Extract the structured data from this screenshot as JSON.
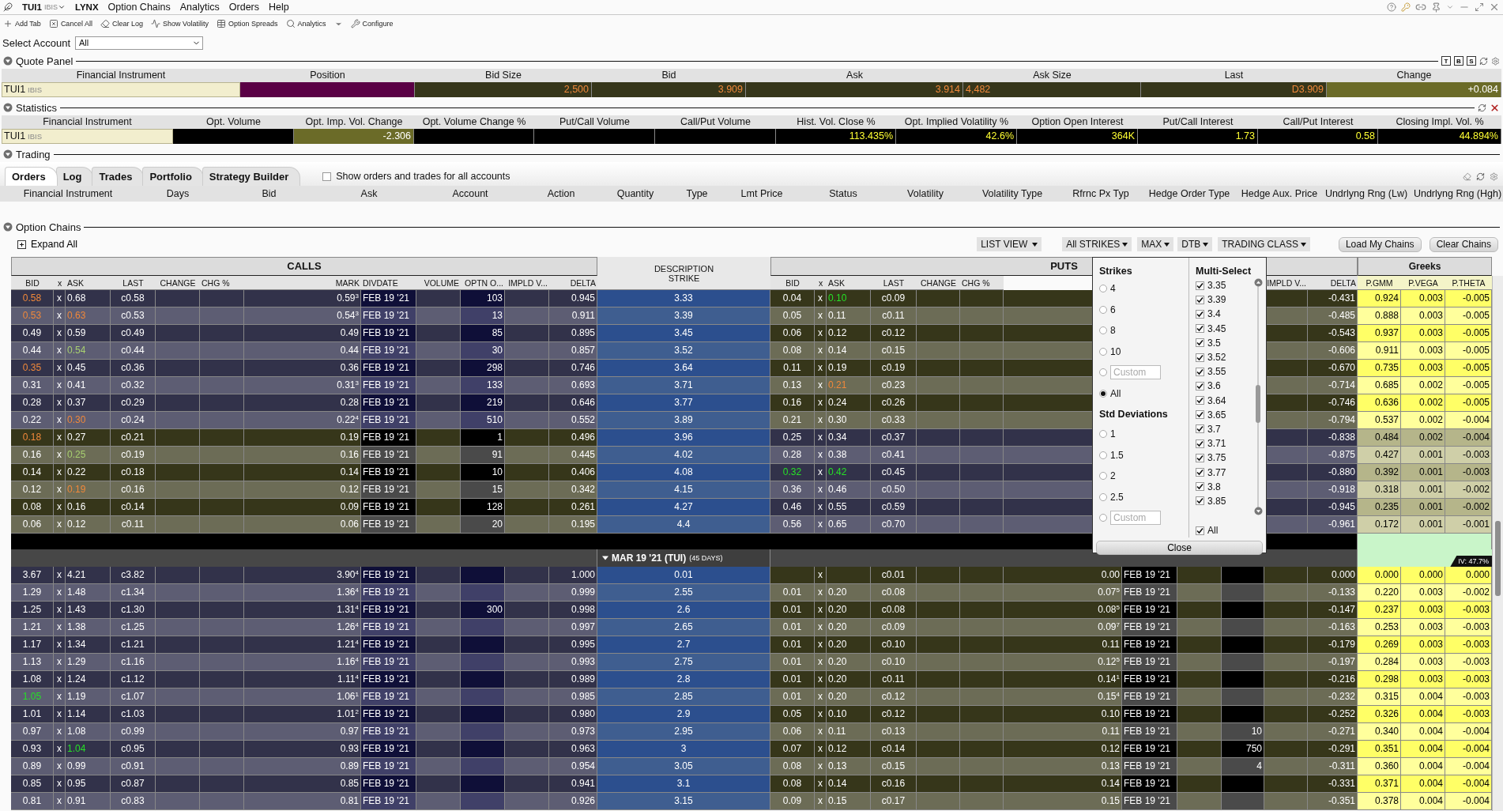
{
  "menu_bar": {
    "symbol": "TUI1",
    "exchange": "IBIS",
    "brand": "LYNX",
    "menus": [
      "Option Chains",
      "Analytics",
      "Orders",
      "Help"
    ]
  },
  "toolbar": [
    {
      "kind": "add",
      "label": "Add Tab"
    },
    {
      "kind": "cancel",
      "label": "Cancel All"
    },
    {
      "kind": "clear",
      "label": "Clear Log"
    },
    {
      "kind": "volatility",
      "label": "Show Volatility"
    },
    {
      "kind": "spreads",
      "label": "Option Spreads"
    },
    {
      "kind": "analytics",
      "label": "Analytics"
    },
    {
      "kind": "dropdown"
    },
    {
      "kind": "configure",
      "label": "Configure"
    }
  ],
  "account": {
    "label": "Select Account",
    "value": "All"
  },
  "quote_panel": {
    "title": "Quote Panel",
    "expanded": true,
    "tools": [
      "T",
      "B",
      "S"
    ],
    "columns": [
      "Financial Instrument",
      "Position",
      "Bid Size",
      "Bid",
      "Ask",
      "Ask Size",
      "Last",
      "Change"
    ],
    "row": {
      "instrument": "TUI1",
      "exchange": "IBIS",
      "bid_size": "2,500",
      "bid": "3.909",
      "ask": "3.914",
      "ask_size": "4,482",
      "last": "D3.909",
      "change": "+0.084"
    }
  },
  "statistics": {
    "title": "Statistics",
    "expanded": true,
    "columns": [
      "Financial Instrument",
      "Opt. Volume",
      "Opt. Imp. Vol. Change",
      "Opt. Volume Change %",
      "Put/Call Volume",
      "Call/Put Volume",
      "Hist. Vol. Close %",
      "Opt. Implied Volatility %",
      "Option Open Interest",
      "Put/Call Interest",
      "Call/Put Interest",
      "Closing Impl. Vol. %"
    ],
    "row": {
      "instrument": "TUI1",
      "exchange": "IBIS",
      "imp_vol_change": "-2.306",
      "hist_vol_close": "113.435%",
      "implied_vol": "42.6%",
      "open_interest": "364K",
      "put_call_interest": "1.73",
      "call_put_interest": "0.58",
      "closing_impl_vol": "44.894%"
    }
  },
  "trading": {
    "title": "Trading",
    "expanded": true,
    "tabs": [
      {
        "label": "Orders",
        "selected": true
      },
      {
        "label": "Log",
        "selected": false
      },
      {
        "label": "Trades",
        "selected": false
      },
      {
        "label": "Portfolio",
        "selected": false
      },
      {
        "label": "Strategy Builder",
        "selected": false
      }
    ],
    "all_accounts": {
      "label": "Show orders and trades for all accounts",
      "checked": false
    },
    "columns": [
      "Financial Instrument",
      "Days",
      "Bid",
      "Ask",
      "Account",
      "Action",
      "Quantity",
      "Type",
      "Lmt Price",
      "Status",
      "Volatility",
      "Volatility Type",
      "Rfrnc Px Typ",
      "Hedge Order Type",
      "Hedge Aux. Price",
      "Undrlyng Rng (Lw)",
      "Undrlyng Rng (Hgh)"
    ]
  },
  "option_chains": {
    "title": "Option Chains",
    "expanded": true,
    "expand_all": "Expand All",
    "controls": [
      {
        "label": "LIST VIEW",
        "kind": "dropdown"
      },
      {
        "label": "All STRIKES",
        "kind": "dropdown"
      },
      {
        "label": "MAX",
        "kind": "dropdown"
      },
      {
        "label": "DTB",
        "kind": "dropdown"
      },
      {
        "label": "TRADING CLASS",
        "kind": "dropdown"
      },
      {
        "label": "Load My Chains",
        "kind": "button"
      },
      {
        "label": "Clear Chains",
        "kind": "button"
      }
    ],
    "strike_popup": {
      "strikes_title": "Strikes",
      "strikes": [
        {
          "label": "4",
          "selected": false
        },
        {
          "label": "6",
          "selected": false
        },
        {
          "label": "8",
          "selected": false
        },
        {
          "label": "10",
          "selected": false
        },
        {
          "placeholder": "Custom",
          "selected": false
        },
        {
          "label": "All",
          "selected": true
        }
      ],
      "std_title": "Std Deviations",
      "std_devs": [
        {
          "label": "1",
          "selected": false
        },
        {
          "label": "1.5",
          "selected": false
        },
        {
          "label": "2",
          "selected": false
        },
        {
          "label": "2.5",
          "selected": false
        },
        {
          "placeholder": "Custom",
          "selected": false
        }
      ],
      "multi_title": "Multi-Select",
      "multi": [
        {
          "label": "3.35",
          "checked": true
        },
        {
          "label": "3.39",
          "checked": true
        },
        {
          "label": "3.4",
          "checked": true
        },
        {
          "label": "3.45",
          "checked": true
        },
        {
          "label": "3.5",
          "checked": true
        },
        {
          "label": "3.52",
          "checked": true
        },
        {
          "label": "3.55",
          "checked": true
        },
        {
          "label": "3.6",
          "checked": true
        },
        {
          "label": "3.64",
          "checked": true
        },
        {
          "label": "3.65",
          "checked": true
        },
        {
          "label": "3.7",
          "checked": true
        },
        {
          "label": "3.71",
          "checked": true
        },
        {
          "label": "3.75",
          "checked": true
        },
        {
          "label": "3.77",
          "checked": true
        },
        {
          "label": "3.8",
          "checked": true
        },
        {
          "label": "3.85",
          "checked": true
        }
      ],
      "multi_all": {
        "label": "All",
        "checked": true
      },
      "close": "Close"
    },
    "chain": {
      "calls_title": "CALLS",
      "puts_title": "PUTS",
      "greeks_title": "Greeks",
      "strike_header": [
        "DESCRIPTION",
        "STRIKE"
      ],
      "call_columns": [
        "BID",
        "x",
        "ASK",
        "LAST",
        "CHANGE",
        "CHG %",
        "MARK",
        "DIVDATE",
        "VOLUME",
        "OPTN O...",
        "IMPLD V...",
        "DELTA"
      ],
      "put_columns_left": [
        "BID",
        "x",
        "ASK",
        "LAST",
        "CHANGE",
        "CHG %"
      ],
      "put_columns_right": [
        "IMPLD V...",
        "DELTA"
      ],
      "greek_columns": [
        "P.GMM",
        "P.VEGA",
        "P.THETA"
      ],
      "groups": [
        {
          "rows": [
            {
              "strike": "3.33",
              "itm": true,
              "call": {
                "bid": {
                  "text": "0.58",
                  "color": "#f0883a"
                },
                "x": "x",
                "ask": "0.68",
                "last": "c0.58",
                "mark": "0.59$^{3}$",
                "divdate": "FEB 19 '21",
                "open_int": "103",
                "delta": "0.945"
              },
              "put": {
                "bid": "0.04",
                "x": "x",
                "ask": {
                  "text": "0.10",
                  "color": "#26e026"
                },
                "last": "c0.09",
                "delta": "-0.431"
              },
              "greeks": [
                "0.924",
                "0.003",
                "-0.005"
              ]
            },
            {
              "strike": "3.39",
              "itm": true,
              "call": {
                "bid": {
                  "text": "0.53",
                  "color": "#f0883a"
                },
                "x": "x",
                "ask": {
                  "text": "0.63",
                  "color": "#f0883a"
                },
                "last": "c0.53",
                "mark": "0.54$^{3}$",
                "divdate": "FEB 19 '21",
                "open_int": "13",
                "delta": "0.911"
              },
              "put": {
                "bid": "0.05",
                "x": "x",
                "ask": "0.11",
                "last": "c0.11",
                "delta": "-0.485"
              },
              "greeks": [
                "0.888",
                "0.003",
                "-0.005"
              ]
            },
            {
              "strike": "3.45",
              "itm": true,
              "call": {
                "bid": "0.49",
                "x": "x",
                "ask": "0.59",
                "last": "c0.49",
                "mark": "0.49",
                "divdate": "FEB 19 '21",
                "open_int": "85",
                "delta": "0.895"
              },
              "put": {
                "bid": "0.06",
                "x": "x",
                "ask": "0.12",
                "last": "c0.12",
                "delta": "-0.543"
              },
              "greeks": [
                "0.937",
                "0.003",
                "-0.005"
              ]
            },
            {
              "strike": "3.52",
              "itm": true,
              "call": {
                "bid": "0.44",
                "x": "x",
                "ask": {
                  "text": "0.54",
                  "color": "#a8d070"
                },
                "last": "c0.44",
                "mark": "0.44",
                "divdate": "FEB 19 '21",
                "open_int": "30",
                "delta": "0.857"
              },
              "put": {
                "bid": "0.08",
                "x": "x",
                "ask": "0.14",
                "last": "c0.15",
                "delta": "-0.606"
              },
              "greeks": [
                "0.911",
                "0.003",
                "-0.005"
              ]
            },
            {
              "strike": "3.64",
              "itm": true,
              "call": {
                "bid": {
                  "text": "0.35",
                  "color": "#f0883a"
                },
                "x": "x",
                "ask": "0.45",
                "last": "c0.36",
                "mark": "0.36",
                "divdate": "FEB 19 '21",
                "open_int": "298",
                "delta": "0.746"
              },
              "put": {
                "bid": "0.11",
                "x": "x",
                "ask": "0.19",
                "last": "c0.19",
                "delta": "-0.670"
              },
              "greeks": [
                "0.735",
                "0.003",
                "-0.005"
              ]
            },
            {
              "strike": "3.71",
              "itm": true,
              "call": {
                "bid": "0.31",
                "x": "x",
                "ask": "0.41",
                "last": "c0.32",
                "mark": "0.31$^{3}$",
                "divdate": "FEB 19 '21",
                "open_int": "133",
                "delta": "0.693"
              },
              "put": {
                "bid": "0.13",
                "x": "x",
                "ask": {
                  "text": "0.21",
                  "color": "#f0883a"
                },
                "last": "c0.23",
                "delta": "-0.714"
              },
              "greeks": [
                "0.685",
                "0.002",
                "-0.005"
              ]
            },
            {
              "strike": "3.77",
              "itm": true,
              "call": {
                "bid": "0.28",
                "x": "x",
                "ask": "0.37",
                "last": "c0.29",
                "mark": "0.28",
                "divdate": "FEB 19 '21",
                "open_int": "219",
                "delta": "0.646"
              },
              "put": {
                "bid": "0.16",
                "x": "x",
                "ask": "0.24",
                "last": "c0.26",
                "delta": "-0.746"
              },
              "greeks": [
                "0.636",
                "0.002",
                "-0.005"
              ]
            },
            {
              "strike": "3.89",
              "itm": true,
              "call": {
                "bid": "0.22",
                "x": "x",
                "ask": {
                  "text": "0.30",
                  "color": "#f0883a"
                },
                "last": "c0.24",
                "mark": "0.22$^{4}$",
                "divdate": "FEB 19 '21",
                "open_int": "510",
                "delta": "0.552"
              },
              "put": {
                "bid": "0.21",
                "x": "x",
                "ask": "0.30",
                "last": "c0.33",
                "delta": "-0.794"
              },
              "greeks": [
                "0.537",
                "0.002",
                "-0.004"
              ]
            },
            {
              "strike": "3.96",
              "itm": false,
              "call": {
                "bid": {
                  "text": "0.18",
                  "color": "#f0883a"
                },
                "x": "x",
                "ask": "0.27",
                "last": "c0.21",
                "mark": "0.19",
                "divdate": "FEB 19 '21",
                "open_int": "1",
                "delta": "0.496"
              },
              "put": {
                "bid": "0.25",
                "x": "x",
                "ask": "0.34",
                "last": "c0.37",
                "delta": "-0.838"
              },
              "greeks": [
                "0.484",
                "0.002",
                "-0.004"
              ]
            },
            {
              "strike": "4.02",
              "itm": false,
              "call": {
                "bid": "0.16",
                "x": "x",
                "ask": {
                  "text": "0.25",
                  "color": "#a8d070"
                },
                "last": "c0.19",
                "mark": "0.16",
                "divdate": "FEB 19 '21",
                "open_int": "91",
                "delta": "0.445"
              },
              "put": {
                "bid": "0.28",
                "x": "x",
                "ask": "0.38",
                "last": "c0.41",
                "delta": "-0.875"
              },
              "greeks": [
                "0.427",
                "0.001",
                "-0.003"
              ]
            },
            {
              "strike": "4.08",
              "itm": false,
              "call": {
                "bid": "0.14",
                "x": "x",
                "ask": "0.22",
                "last": "c0.18",
                "mark": "0.14",
                "divdate": "FEB 19 '21",
                "open_int": "10",
                "delta": "0.406"
              },
              "put": {
                "bid": {
                  "text": "0.32",
                  "color": "#26e026"
                },
                "x": "x",
                "ask": {
                  "text": "0.42",
                  "color": "#26e026"
                },
                "last": "c0.45",
                "delta": "-0.880"
              },
              "greeks": [
                "0.392",
                "0.001",
                "-0.003"
              ]
            },
            {
              "strike": "4.15",
              "itm": false,
              "call": {
                "bid": "0.12",
                "x": "x",
                "ask": {
                  "text": "0.19",
                  "color": "#f0883a"
                },
                "last": "c0.16",
                "mark": "0.12",
                "divdate": "FEB 19 '21",
                "open_int": "15",
                "delta": "0.342"
              },
              "put": {
                "bid": "0.36",
                "x": "x",
                "ask": "0.46",
                "last": "c0.50",
                "delta": "-0.918"
              },
              "greeks": [
                "0.318",
                "0.001",
                "-0.002"
              ]
            },
            {
              "strike": "4.27",
              "itm": false,
              "call": {
                "bid": "0.08",
                "x": "x",
                "ask": "0.16",
                "last": "c0.14",
                "mark": "0.09",
                "divdate": "FEB 19 '21",
                "open_int": "128",
                "delta": "0.261"
              },
              "put": {
                "bid": "0.46",
                "x": "x",
                "ask": "0.55",
                "last": "c0.59",
                "delta": "-0.945"
              },
              "greeks": [
                "0.235",
                "0.001",
                "-0.002"
              ]
            },
            {
              "strike": "4.4",
              "itm": false,
              "call": {
                "bid": "0.06",
                "x": "x",
                "ask": "0.12",
                "last": "c0.11",
                "mark": "0.06",
                "divdate": "FEB 19 '21",
                "open_int": "20",
                "delta": "0.195"
              },
              "put": {
                "bid": "0.56",
                "x": "x",
                "ask": "0.65",
                "last": "c0.70",
                "delta": "-0.961"
              },
              "greeks": [
                "0.172",
                "0.001",
                "-0.001"
              ]
            }
          ]
        },
        {
          "expiry": {
            "label": "MAR 19 '21 (TUI)",
            "days": "(45 DAYS)",
            "expanded": true,
            "iv": "IV: 47.7%"
          },
          "rows": [
            {
              "strike": "0.01",
              "itm": true,
              "call": {
                "bid": "3.67",
                "x": "x",
                "ask": "4.21",
                "last": "c3.82",
                "mark": "3.90$^{4}$",
                "divdate": "FEB 19 '21",
                "delta": "1.000"
              },
              "put": {
                "x": "x",
                "last": "c0.01",
                "mark": "0.00",
                "divdate": "FEB 19 '21",
                "delta": "0.000"
              },
              "greeks": [
                "0.000",
                "0.000",
                "0.000"
              ]
            },
            {
              "strike": "2.55",
              "itm": true,
              "call": {
                "bid": "1.29",
                "x": "x",
                "ask": "1.48",
                "last": "c1.34",
                "mark": "1.36$^{4}$",
                "divdate": "FEB 19 '21",
                "delta": "0.999"
              },
              "put": {
                "bid": "0.01",
                "x": "x",
                "ask": "0.20",
                "last": "c0.08",
                "mark": "0.07$^{5}$",
                "divdate": "FEB 19 '21",
                "delta": "-0.133"
              },
              "greeks": [
                "0.220",
                "0.003",
                "-0.002"
              ]
            },
            {
              "strike": "2.6",
              "itm": true,
              "call": {
                "bid": "1.25",
                "x": "x",
                "ask": "1.43",
                "last": "c1.30",
                "mark": "1.31$^{4}$",
                "divdate": "FEB 19 '21",
                "open_int": "300",
                "delta": "0.998"
              },
              "put": {
                "bid": "0.01",
                "x": "x",
                "ask": "0.20",
                "last": "c0.08",
                "mark": "0.08$^{5}$",
                "divdate": "FEB 19 '21",
                "delta": "-0.147"
              },
              "greeks": [
                "0.237",
                "0.003",
                "-0.003"
              ]
            },
            {
              "strike": "2.65",
              "itm": true,
              "call": {
                "bid": "1.21",
                "x": "x",
                "ask": "1.38",
                "last": "c1.25",
                "mark": "1.26$^{4}$",
                "divdate": "FEB 19 '21",
                "delta": "0.997"
              },
              "put": {
                "bid": "0.01",
                "x": "x",
                "ask": "0.20",
                "last": "c0.09",
                "mark": "0.09$^{7}$",
                "divdate": "FEB 19 '21",
                "delta": "-0.163"
              },
              "greeks": [
                "0.253",
                "0.003",
                "-0.003"
              ]
            },
            {
              "strike": "2.7",
              "itm": true,
              "call": {
                "bid": "1.17",
                "x": "x",
                "ask": "1.34",
                "last": "c1.21",
                "mark": "1.21$^{4}$",
                "divdate": "FEB 19 '21",
                "delta": "0.995"
              },
              "put": {
                "bid": "0.01",
                "x": "x",
                "ask": "0.20",
                "last": "c0.10",
                "mark": "0.11",
                "divdate": "FEB 19 '21",
                "delta": "-0.179"
              },
              "greeks": [
                "0.269",
                "0.003",
                "-0.003"
              ]
            },
            {
              "strike": "2.75",
              "itm": true,
              "call": {
                "bid": "1.13",
                "x": "x",
                "ask": "1.29",
                "last": "c1.16",
                "mark": "1.16$^{4}$",
                "divdate": "FEB 19 '21",
                "delta": "0.993"
              },
              "put": {
                "bid": "0.01",
                "x": "x",
                "ask": "0.20",
                "last": "c0.10",
                "mark": "0.12$^{5}$",
                "divdate": "FEB 19 '21",
                "delta": "-0.197"
              },
              "greeks": [
                "0.284",
                "0.003",
                "-0.003"
              ]
            },
            {
              "strike": "2.8",
              "itm": true,
              "call": {
                "bid": "1.08",
                "x": "x",
                "ask": "1.24",
                "last": "c1.12",
                "mark": "1.11$^{4}$",
                "divdate": "FEB 19 '21",
                "delta": "0.989"
              },
              "put": {
                "bid": "0.01",
                "x": "x",
                "ask": "0.20",
                "last": "c0.11",
                "mark": "0.14$^{1}$",
                "divdate": "FEB 19 '21",
                "delta": "-0.216"
              },
              "greeks": [
                "0.298",
                "0.003",
                "-0.003"
              ]
            },
            {
              "strike": "2.85",
              "itm": true,
              "call": {
                "bid": {
                  "text": "1.05",
                  "color": "#26e026"
                },
                "x": "x",
                "ask": "1.19",
                "last": "c1.07",
                "mark": "1.06$^{1}$",
                "divdate": "FEB 19 '21",
                "delta": "0.985"
              },
              "put": {
                "bid": "0.01",
                "x": "x",
                "ask": "0.20",
                "last": "c0.12",
                "mark": "0.15$^{4}$",
                "divdate": "FEB 19 '21",
                "delta": "-0.232"
              },
              "greeks": [
                "0.315",
                "0.004",
                "-0.003"
              ]
            },
            {
              "strike": "2.9",
              "itm": true,
              "call": {
                "bid": "1.01",
                "x": "x",
                "ask": "1.14",
                "last": "c1.03",
                "mark": "1.01$^{2}$",
                "divdate": "FEB 19 '21",
                "delta": "0.980"
              },
              "put": {
                "bid": "0.05",
                "x": "x",
                "ask": "0.10",
                "last": "c0.12",
                "mark": "0.10",
                "divdate": "FEB 19 '21",
                "delta": "-0.252"
              },
              "greeks": [
                "0.326",
                "0.004",
                "-0.003"
              ]
            },
            {
              "strike": "2.95",
              "itm": true,
              "call": {
                "bid": "0.97",
                "x": "x",
                "ask": "1.08",
                "last": "c0.99",
                "mark": "0.97",
                "divdate": "FEB 19 '21",
                "delta": "0.973"
              },
              "put": {
                "bid": "0.06",
                "x": "x",
                "ask": "0.11",
                "last": "c0.13",
                "mark": "0.11",
                "divdate": "FEB 19 '21",
                "open_int": "10",
                "delta": "-0.271"
              },
              "greeks": [
                "0.340",
                "0.004",
                "-0.004"
              ]
            },
            {
              "strike": "3",
              "itm": true,
              "call": {
                "bid": "0.93",
                "x": "x",
                "ask": {
                  "text": "1.04",
                  "color": "#26e026"
                },
                "last": "c0.95",
                "mark": "0.93",
                "divdate": "FEB 19 '21",
                "delta": "0.963"
              },
              "put": {
                "bid": "0.07",
                "x": "x",
                "ask": "0.12",
                "last": "c0.14",
                "mark": "0.12",
                "divdate": "FEB 19 '21",
                "open_int": "750",
                "delta": "-0.291"
              },
              "greeks": [
                "0.351",
                "0.004",
                "-0.004"
              ]
            },
            {
              "strike": "3.05",
              "itm": true,
              "call": {
                "bid": "0.89",
                "x": "x",
                "ask": "0.99",
                "last": "c0.91",
                "mark": "0.89",
                "divdate": "FEB 19 '21",
                "delta": "0.954"
              },
              "put": {
                "bid": "0.08",
                "x": "x",
                "ask": "0.13",
                "last": "c0.15",
                "mark": "0.13",
                "divdate": "FEB 19 '21",
                "open_int": "4",
                "delta": "-0.311"
              },
              "greeks": [
                "0.360",
                "0.004",
                "-0.004"
              ]
            },
            {
              "strike": "3.1",
              "itm": true,
              "call": {
                "bid": "0.85",
                "x": "x",
                "ask": "0.95",
                "last": "c0.87",
                "mark": "0.85",
                "divdate": "FEB 19 '21",
                "delta": "0.941"
              },
              "put": {
                "bid": "0.08",
                "x": "x",
                "ask": "0.14",
                "last": "c0.16",
                "mark": "0.14",
                "divdate": "FEB 19 '21",
                "delta": "-0.331"
              },
              "greeks": [
                "0.371",
                "0.004",
                "-0.004"
              ]
            },
            {
              "strike": "3.15",
              "itm": true,
              "call": {
                "bid": "0.81",
                "x": "x",
                "ask": "0.91",
                "last": "c0.83",
                "mark": "0.81",
                "divdate": "FEB 19 '21",
                "delta": "0.926"
              },
              "put": {
                "bid": "0.09",
                "x": "x",
                "ask": "0.15",
                "last": "c0.17",
                "mark": "0.15",
                "divdate": "FEB 19 '21",
                "delta": "-0.351"
              },
              "greeks": [
                "0.378",
                "0.004",
                "-0.004"
              ]
            }
          ]
        }
      ]
    }
  }
}
